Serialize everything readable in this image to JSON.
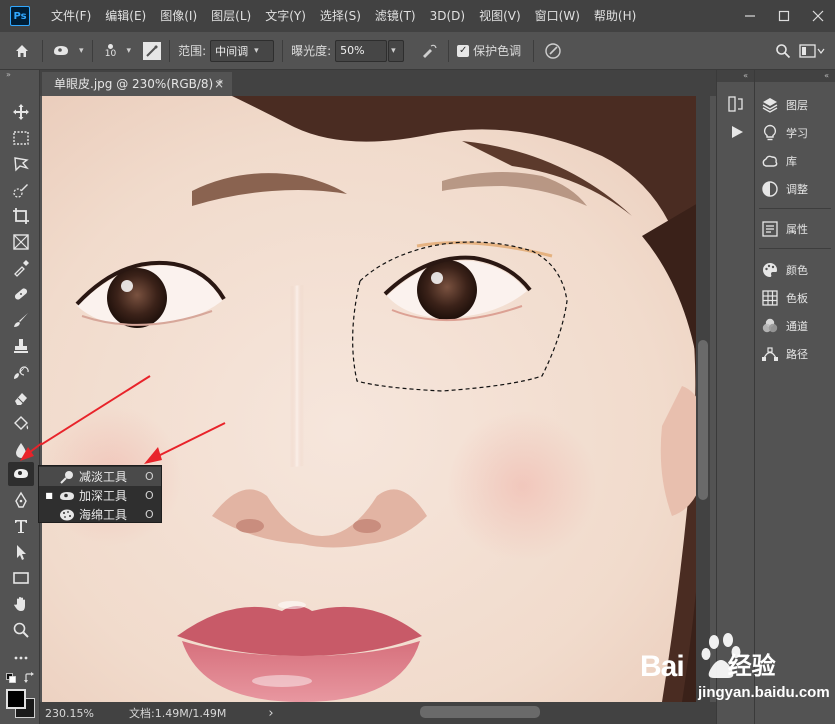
{
  "app": {
    "logo": "Ps",
    "menu": [
      "文件(F)",
      "编辑(E)",
      "图像(I)",
      "图层(L)",
      "文字(Y)",
      "选择(S)",
      "滤镜(T)",
      "3D(D)",
      "视图(V)",
      "窗口(W)",
      "帮助(H)"
    ],
    "window_controls": [
      "minimize-icon",
      "restore-icon",
      "close-icon"
    ]
  },
  "options_bar": {
    "brush_size": "10",
    "range_label": "范围:",
    "range_value": "中间调",
    "exposure_label": "曝光度:",
    "exposure_value": "50%",
    "protect_tones_label": "保护色调",
    "protect_tones_checked": true
  },
  "document": {
    "tab_title": "单眼皮.jpg @ 230%(RGB/8) *",
    "close": "×"
  },
  "status": {
    "zoom": "230.15%",
    "doc_info": "文档:1.49M/1.49M",
    "arrow": "›"
  },
  "tools_flyout": {
    "items": [
      {
        "label": "减淡工具",
        "shortcut": "O",
        "icon": "dodge-icon",
        "selected": false
      },
      {
        "label": "加深工具",
        "shortcut": "O",
        "icon": "burn-icon",
        "selected": true
      },
      {
        "label": "海绵工具",
        "shortcut": "O",
        "icon": "sponge-icon",
        "selected": false
      }
    ]
  },
  "panels": {
    "group1": [
      "图层",
      "学习",
      "库",
      "调整"
    ],
    "group2": [
      "属性"
    ],
    "group3": [
      "颜色",
      "色板",
      "通道",
      "路径"
    ]
  },
  "watermark": {
    "brand": "Bai",
    "brand_suffix": "经验",
    "url": "jingyan.baidu.com"
  },
  "colors": {
    "ui_dark": "#424242",
    "ui_mid": "#535353",
    "annotation_arrow": "#e8232a",
    "accent": "#31a8ff"
  }
}
